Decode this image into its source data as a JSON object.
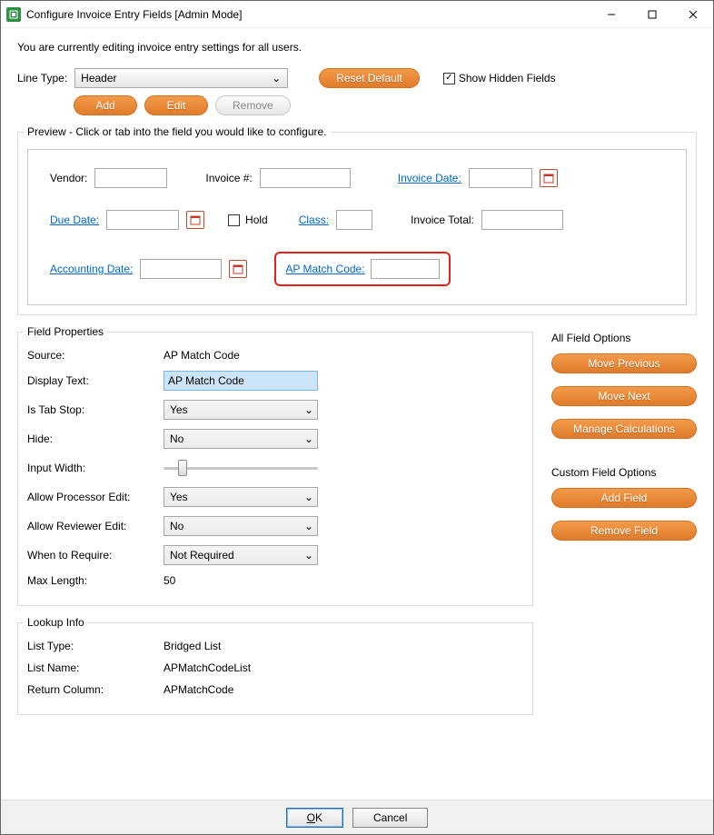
{
  "window": {
    "title": "Configure Invoice Entry Fields [Admin Mode]"
  },
  "info_line": "You are currently editing invoice entry settings for all users.",
  "line_type": {
    "label": "Line Type:",
    "value": "Header"
  },
  "buttons": {
    "reset_default": "Reset Default",
    "show_hidden": "Show Hidden Fields",
    "add": "Add",
    "edit": "Edit",
    "remove": "Remove"
  },
  "preview": {
    "title": "Preview - Click or tab into the field you would like to configure.",
    "vendor": "Vendor:",
    "invoice_num": "Invoice #:",
    "invoice_date": "Invoice Date:",
    "due_date": "Due Date:",
    "hold": "Hold",
    "class": "Class:",
    "invoice_total": "Invoice Total:",
    "accounting_date": "Accounting Date:",
    "ap_match_code": "AP Match Code:"
  },
  "field_properties": {
    "title": "Field Properties",
    "source_label": "Source:",
    "source_value": "AP Match Code",
    "display_text_label": "Display Text:",
    "display_text_value": "AP Match Code",
    "is_tab_stop_label": "Is Tab Stop:",
    "is_tab_stop_value": "Yes",
    "hide_label": "Hide:",
    "hide_value": "No",
    "input_width_label": "Input Width:",
    "allow_processor_label": "Allow Processor Edit:",
    "allow_processor_value": "Yes",
    "allow_reviewer_label": "Allow Reviewer Edit:",
    "allow_reviewer_value": "No",
    "when_to_require_label": "When to Require:",
    "when_to_require_value": "Not Required",
    "max_length_label": "Max Length:",
    "max_length_value": "50"
  },
  "all_field_options": {
    "title": "All Field Options",
    "move_previous": "Move Previous",
    "move_next": "Move Next",
    "manage_calc": "Manage Calculations"
  },
  "custom_field_options": {
    "title": "Custom Field Options",
    "add_field": "Add Field",
    "remove_field": "Remove Field"
  },
  "lookup": {
    "title": "Lookup Info",
    "list_type_label": "List Type:",
    "list_type_value": "Bridged List",
    "list_name_label": "List Name:",
    "list_name_value": "APMatchCodeList",
    "return_column_label": "Return Column:",
    "return_column_value": "APMatchCode"
  },
  "footer": {
    "ok": "OK",
    "cancel": "Cancel"
  }
}
